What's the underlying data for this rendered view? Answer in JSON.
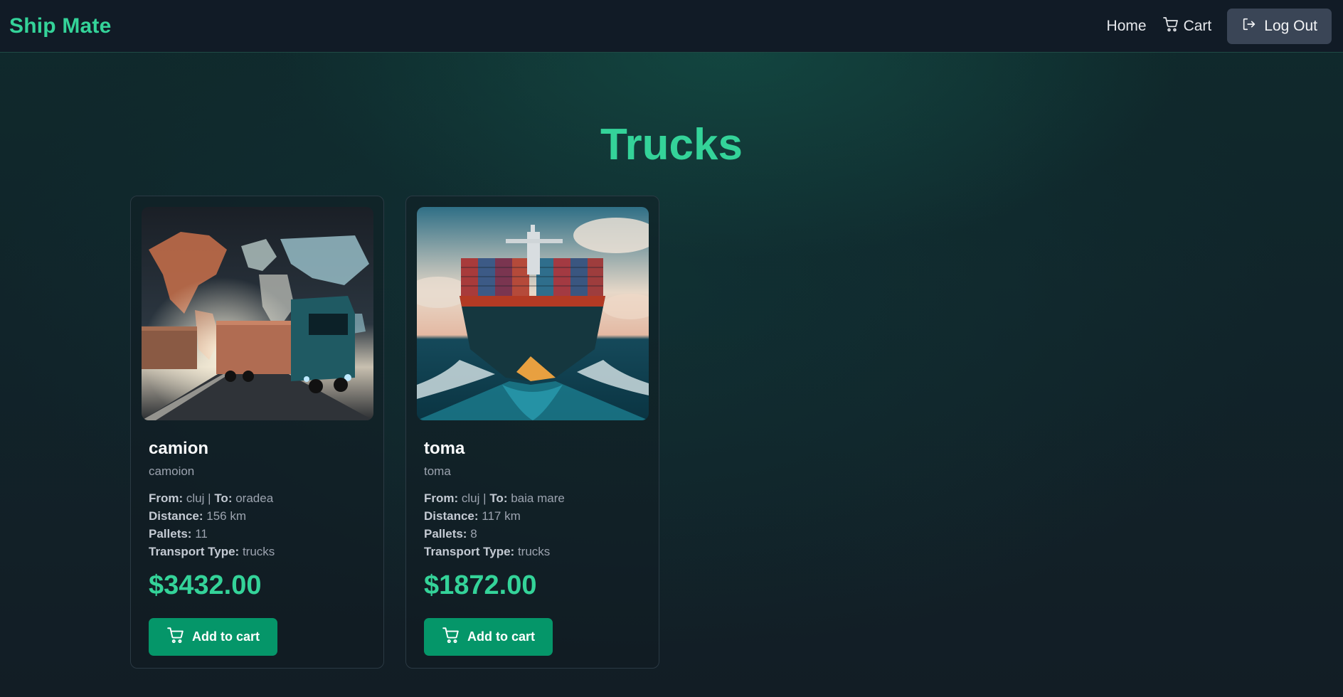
{
  "brand": "Ship Mate",
  "nav": {
    "home_label": "Home",
    "cart_label": "Cart",
    "logout_label": "Log Out",
    "icons": {
      "cart": "cart-icon",
      "logout": "logout-icon"
    }
  },
  "page": {
    "title": "Trucks"
  },
  "colors": {
    "accent": "#34d399",
    "button": "#059669",
    "logout_bg": "#3a4556"
  },
  "cards": [
    {
      "image_name": "world-map-truck-image",
      "title": "camion",
      "subtitle": "camoion",
      "from_label": "From:",
      "from": "cluj",
      "separator": "|",
      "to_label": "To:",
      "to": "oradea",
      "distance_label": "Distance:",
      "distance": "156 km",
      "pallets_label": "Pallets:",
      "pallets": "11",
      "type_label": "Transport Type:",
      "type": "trucks",
      "price": "$3432.00",
      "button_label": "Add to cart"
    },
    {
      "image_name": "container-ship-image",
      "title": "toma",
      "subtitle": "toma",
      "from_label": "From:",
      "from": "cluj",
      "separator": "|",
      "to_label": "To:",
      "to": "baia mare",
      "distance_label": "Distance:",
      "distance": "117 km",
      "pallets_label": "Pallets:",
      "pallets": "8",
      "type_label": "Transport Type:",
      "type": "trucks",
      "price": "$1872.00",
      "button_label": "Add to cart"
    }
  ]
}
